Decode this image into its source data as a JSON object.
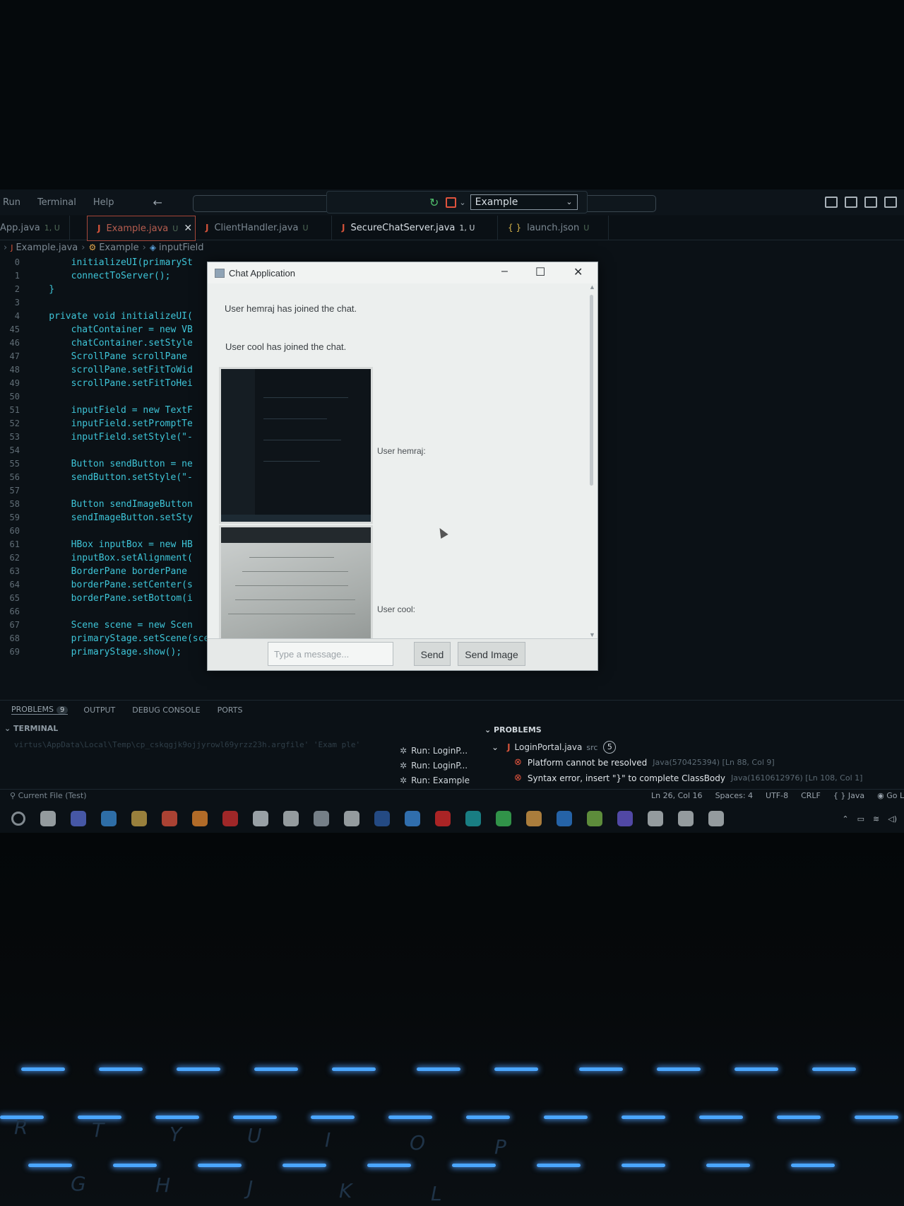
{
  "titlebar": {
    "menu": [
      "Run",
      "Terminal",
      "Help"
    ],
    "run_config": "Example"
  },
  "tabs": [
    {
      "label": "App.java",
      "suffix": "1, U",
      "icon": "java-file-icon",
      "active": false
    },
    {
      "label": "Example.java",
      "suffix": "U",
      "icon": "java-file-icon",
      "active": true
    },
    {
      "label": "ClientHandler.java",
      "suffix": "U",
      "icon": "java-file-icon",
      "active": false
    },
    {
      "label": "SecureChatServer.java",
      "suffix": "1, U",
      "icon": "java-file-icon",
      "active": false
    },
    {
      "label": "launch.json",
      "suffix": "U",
      "icon": "json-file-icon",
      "active": false
    }
  ],
  "breadcrumb": [
    "Example.java",
    "Example",
    "inputField"
  ],
  "editor": {
    "line_numbers": [
      "0",
      "1",
      "2",
      "3",
      "4",
      "45",
      "46",
      "47",
      "48",
      "49",
      "50",
      "51",
      "52",
      "53",
      "54",
      "55",
      "56",
      "57",
      "58",
      "59",
      "60",
      "61",
      "62",
      "63",
      "64",
      "65",
      "66",
      "67",
      "68",
      "69"
    ],
    "lines": [
      "        initializeUI(primarySt",
      "        connectToServer();",
      "    }",
      "",
      "    private void initializeUI(",
      "        chatContainer = new VB",
      "        chatContainer.setStyle",
      "        ScrollPane scrollPane",
      "        scrollPane.setFitToWid",
      "        scrollPane.setFitToHei",
      "",
      "        inputField = new TextF",
      "        inputField.setPromptTe",
      "        inputField.setStyle(\"-",
      "",
      "        Button sendButton = ne",
      "        sendButton.setStyle(\"-",
      "",
      "        Button sendImageButton",
      "        sendImageButton.setSty",
      "",
      "        HBox inputBox = new HB",
      "        inputBox.setAlignment(",
      "        BorderPane borderPane ",
      "        borderPane.setCenter(s",
      "        borderPane.setBottom(i",
      "",
      "        Scene scene = new Scen",
      "        primaryStage.setScene(scene);",
      "        primaryStage.show();"
    ]
  },
  "chat": {
    "title": "Chat Application",
    "messages": [
      "User hemraj has joined the chat.",
      "User cool has joined the chat."
    ],
    "image_labels": [
      "User hemraj:",
      "User cool:"
    ],
    "input_placeholder": "Type a message...",
    "send_label": "Send",
    "send_image_label": "Send Image"
  },
  "panel": {
    "tabs": [
      "PROBLEMS",
      "OUTPUT",
      "DEBUG CONSOLE",
      "PORTS"
    ],
    "problems_count": "9",
    "terminal_header": "TERMINAL",
    "terminal_text": "virtus\\AppData\\Local\\Temp\\cp_cskqgjk9ojjyrowl69yrzz23h.argfile' 'Exam ple'",
    "run_items": [
      "Run: LoginP...",
      "Run: LoginP...",
      "Run: Example"
    ],
    "problems_header": "PROBLEMS",
    "problem_file": "LoginPortal.java",
    "problem_file_dir": "src",
    "problem_file_count": "5",
    "errors": [
      {
        "message": "Platform cannot be resolved",
        "source": "Java(570425394) [Ln 88, Col 9]"
      },
      {
        "message": "Syntax error, insert \"}\" to complete ClassBody",
        "source": "Java(1610612976) [Ln 108, Col 1]"
      }
    ]
  },
  "status": {
    "left": "Current File (Test)",
    "cursor": "Ln 26, Col 16",
    "spaces": "Spaces: 4",
    "encoding": "UTF-8",
    "eol": "CRLF",
    "language": "{ } Java",
    "golive": "Go Live"
  },
  "taskbar_icons": [
    "search-icon",
    "task-view-icon",
    "teams-icon",
    "widgets-icon",
    "store-icon",
    "app-icon",
    "firefox-icon",
    "mcafee-icon",
    "app-icon",
    "cube-icon",
    "settings-icon",
    "terminal-icon",
    "photoshop-icon",
    "todo-icon",
    "youtube-icon",
    "edge-icon",
    "whatsapp-icon",
    "chrome-icon",
    "vscode-icon",
    "app-icon",
    "messenger-icon",
    "java-icon",
    "java-icon",
    "java-icon"
  ],
  "colors": {
    "editor_bg": "#0b1116",
    "code": "#3ec5d8",
    "error": "#e0533d",
    "keyboard_light": "#4aa6ff"
  },
  "keyboard_letters": [
    "Y",
    "U",
    "I",
    "O",
    "P",
    "G",
    "H",
    "J",
    "K",
    "L",
    "T",
    "R"
  ]
}
